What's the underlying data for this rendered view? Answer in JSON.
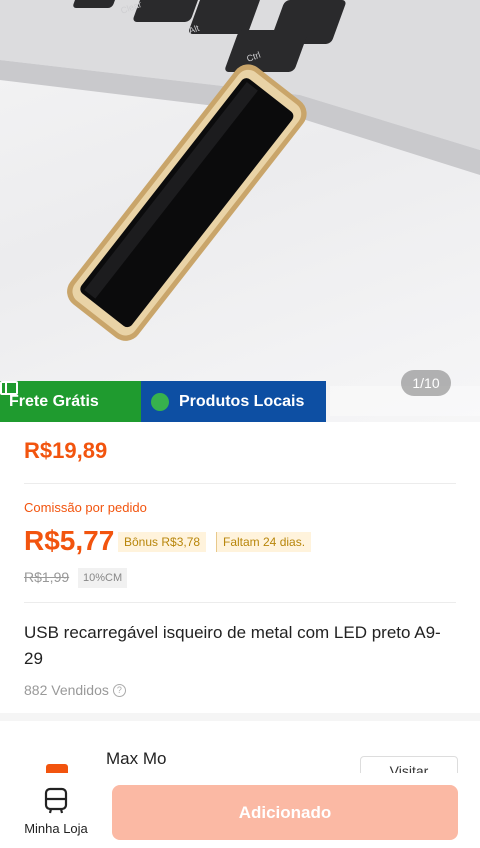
{
  "gallery": {
    "page_indicator": "1/10",
    "badges": {
      "free_shipping": "Frete Grátis",
      "local_products": "Produtos Locais"
    }
  },
  "price": {
    "current": "R$19,89"
  },
  "commission": {
    "label": "Comissão por pedido",
    "value": "R$5,77",
    "bonus": "Bônus R$3,78",
    "days_left": "Faltam 24 dias.",
    "old_price": "R$1,99",
    "cm_tag": "10%CM"
  },
  "product": {
    "title": "USB recarregável isqueiro de metal com LED preto A9-29",
    "sold": "882 Vendidos"
  },
  "shop": {
    "name": "Max Mo",
    "visit_label": "Visitar"
  },
  "bottom_bar": {
    "store_label": "Minha Loja",
    "add_button": "Adicionado"
  },
  "colors": {
    "accent": "#f2540e",
    "free_shipping_badge": "#1f9b2f",
    "local_badge": "#0d4fa3",
    "add_button_disabled": "#fbb9a4"
  }
}
